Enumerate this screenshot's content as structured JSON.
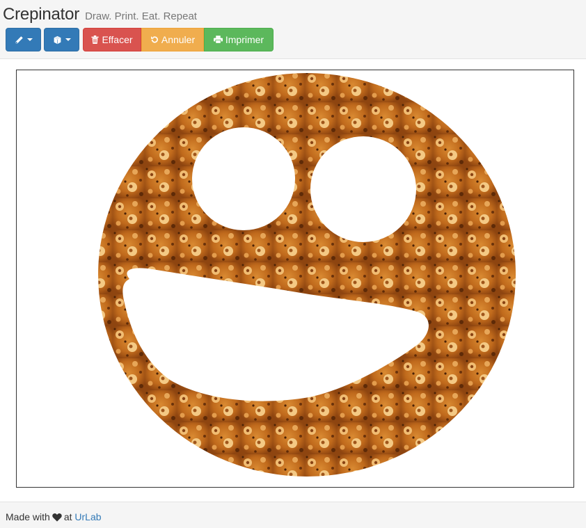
{
  "header": {
    "title": "Crepinator",
    "tagline": "Draw. Print. Eat. Repeat"
  },
  "toolbar": {
    "pen_icon": "pencil-icon",
    "shape_icon": "cube-icon",
    "clear_label": "Effacer",
    "clear_icon": "trash-icon",
    "undo_label": "Annuler",
    "undo_icon": "undo-icon",
    "print_label": "Imprimer",
    "print_icon": "print-icon",
    "colors": {
      "primary": "#337ab7",
      "danger": "#d9534f",
      "warning": "#f0ad4e",
      "success": "#5cb85c"
    }
  },
  "canvas": {
    "content": "pancake smiley face",
    "fill_color": "#c8741e"
  },
  "footer": {
    "prefix": "Made with",
    "heart_icon": "heart-icon",
    "middle": "at",
    "link": "UrLab"
  }
}
